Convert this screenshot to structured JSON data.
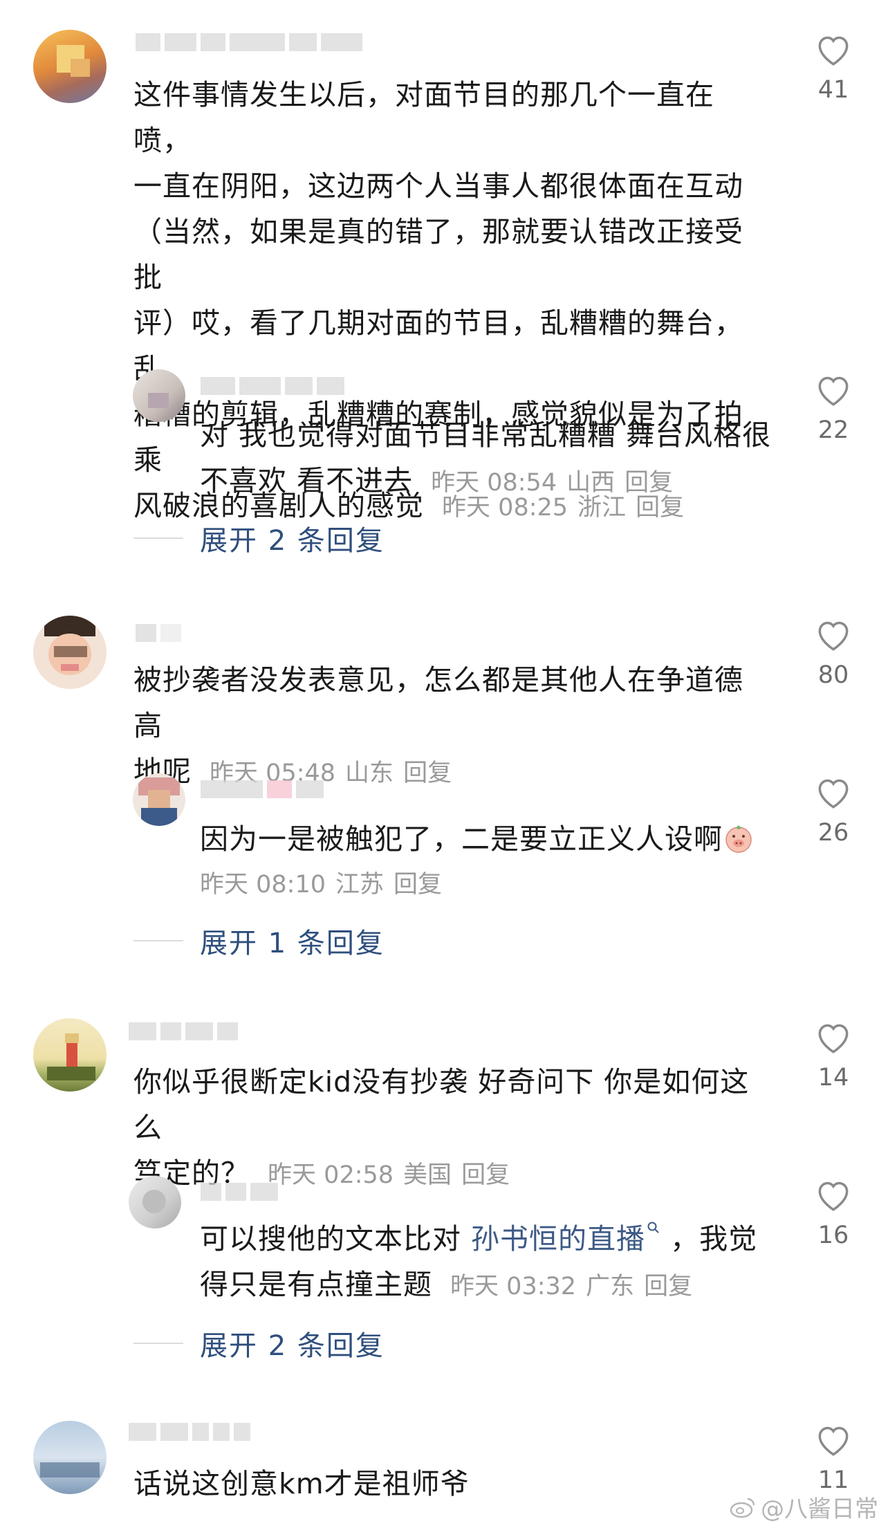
{
  "comments": [
    {
      "text": "这件事情发生以后，对面节目的那几个一直在喷，一直在阴阳，这边两个人当事人都很体面在互动（当然，如果是真的错了，那就要认错改正接受批评）哎，看了几期对面的节目，乱糟糟的舞台，乱糟糟的剪辑，乱糟糟的赛制，感觉貌似是为了拍乘风破浪的喜剧人的感觉",
      "lines": [
        "这件事情发生以后，对面节目的那几个一直在喷，",
        "一直在阴阳，这边两个人当事人都很体面在互动",
        "（当然，如果是真的错了，那就要认错改正接受批",
        "评）哎，看了几期对面的节目，乱糟糟的舞台，乱",
        "糟糟的剪辑，乱糟糟的赛制，感觉貌似是为了拍乘",
        "风破浪的喜剧人的感觉"
      ],
      "time": "昨天 08:25",
      "location": "浙江",
      "reply": "回复",
      "likes": "41"
    },
    {
      "lines": [
        "对 我也觉得对面节目非常乱糟糟 舞台风格很",
        "不喜欢 看不进去"
      ],
      "time": "昨天 08:54",
      "location": "山西",
      "reply": "回复",
      "likes": "22"
    },
    {
      "lines": [
        "被抄袭者没发表意见，怎么都是其他人在争道德高",
        "地呢"
      ],
      "time": "昨天 05:48",
      "location": "山东",
      "reply": "回复",
      "likes": "80"
    },
    {
      "lines": [
        "因为一是被触犯了，二是要立正义人设啊"
      ],
      "time": "昨天 08:10",
      "location": "江苏",
      "reply": "回复",
      "likes": "26"
    },
    {
      "lines": [
        "你似乎很断定kid没有抄袭 好奇问下 你是如何这么",
        "笃定的？"
      ],
      "time": "昨天 02:58",
      "location": "美国",
      "reply": "回复",
      "likes": "14"
    },
    {
      "line1_pre": "可以搜他的文本比对 ",
      "line1_link": "孙书恒的直播",
      "line1_post": " ，我觉",
      "line2": "得只是有点撞主题",
      "time": "昨天 03:32",
      "location": "广东",
      "reply": "回复",
      "likes": "16"
    },
    {
      "lines": [
        "话说这创意km才是祖师爷"
      ],
      "likes": "11"
    }
  ],
  "expand": [
    {
      "label": "展开 2 条回复"
    },
    {
      "label": "展开 1 条回复"
    },
    {
      "label": "展开 2 条回复"
    }
  ],
  "watermark": "@八酱日常",
  "icons": {
    "like": "heart-outline-icon",
    "search": "search-icon",
    "emoji": "pig-face-emoji-icon",
    "watermark": "weibo-logo-icon"
  },
  "colors": {
    "text": "#1a1a1a",
    "meta": "#9a9a9a",
    "link": "#3d5a86",
    "expand": "#2f4f7d"
  }
}
